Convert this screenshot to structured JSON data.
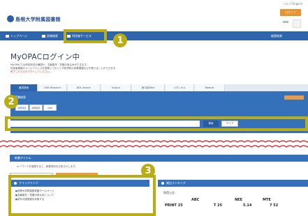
{
  "header": {
    "logo_text": "島根大学附属図書館",
    "top_links": "ヘルプ  English",
    "login_label": "ログイン"
  },
  "nav": {
    "items": [
      "トップページ",
      "詳細検索",
      "利用者サービス",
      "検索結果",
      "文献複写・貸借"
    ]
  },
  "page": {
    "title": "MyOPACログイン中",
    "intro_lines": [
      "MyOPACでは利用状況の確認や、文献複写・貸借の申込みができます。",
      "利用者情報のメールアドレスを登録しておくと予約資料の到着連絡などを受けることができます。",
      "終了したらログアウトしてください。"
    ]
  },
  "tabs": [
    "蔵書検索",
    "CiNii Research",
    "NDL Search",
    "Scopus",
    "医中誌Web",
    "メディカル",
    "Webcat"
  ],
  "search": {
    "heading": "蔵書検索",
    "subtabs": [
      "簡易検索",
      "詳細検索",
      "ISBN"
    ],
    "input_value": "",
    "search_label": "検索",
    "clear_label": "クリア"
  },
  "recent": {
    "title": "新着アイテム",
    "text": "キーワードを登録すると、新着資料をお知らせします。"
  },
  "quicklinks": {
    "title": "クイックリンク",
    "items": [
      "島根大学附属図書館ホームページ",
      "文献複写・貸借の申込みについて",
      "学外の図書館を利用する"
    ]
  },
  "ranking": {
    "title": "貸出ランキング",
    "row1": [
      "利用上位",
      "ABC",
      "NEE",
      "MTE"
    ],
    "row2": [
      "PRINT 25",
      "T 25",
      "5.14",
      "7 52"
    ]
  },
  "annotations": [
    "1",
    "2",
    "3"
  ],
  "colors": {
    "nav_blue": "#2f65ad",
    "panel_blue": "#3571ba",
    "accent_orange": "#ec9b45",
    "highlight_olive": "#b9ac14",
    "wave_red": "#d9232a"
  }
}
